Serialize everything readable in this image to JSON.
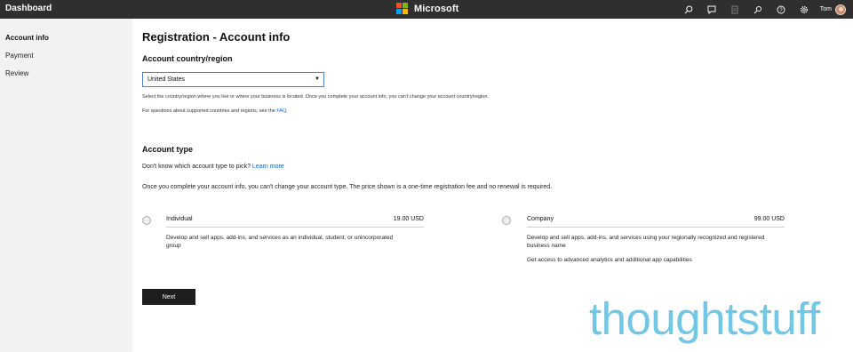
{
  "topbar": {
    "dashboard": "Dashboard",
    "brand": "Microsoft",
    "user": "Tom",
    "icons": [
      "search-icon",
      "chat-icon",
      "document-icon",
      "feedback-icon",
      "help-icon",
      "gear-icon"
    ]
  },
  "sidebar": {
    "items": [
      {
        "label": "Account info",
        "active": true
      },
      {
        "label": "Payment",
        "active": false
      },
      {
        "label": "Review",
        "active": false
      }
    ]
  },
  "main": {
    "title": "Registration - Account info",
    "country": {
      "heading": "Account country/region",
      "selected": "United States",
      "help1": "Select the country/region where you live or where your business is located. Once you complete your account info, you can't change your account country/region.",
      "help2_prefix": "For questions about supported countries and regions, see the ",
      "help2_link": "FAQ",
      "help2_suffix": "."
    },
    "account_type": {
      "heading": "Account type",
      "pick_prefix": "Don't know which account type to pick? ",
      "pick_link": "Learn more",
      "note": "Once you complete your account info, you can't change your account type. The price shown is a one-time registration fee and no renewal is required.",
      "individual": {
        "title": "Individual",
        "price": "19.00 USD",
        "desc": "Develop and sell apps, add-ins, and services as an individual, student, or unincorporated group"
      },
      "company": {
        "title": "Company",
        "price": "99.00 USD",
        "desc1": "Develop and sell apps, add-ins, and services using your regionally recognized and registered business name",
        "desc2": "Get access to advanced analytics and additional app capabilities"
      }
    },
    "next_label": "Next"
  },
  "watermark": "thoughtstuff",
  "colors": {
    "topbar_bg": "#2f2f2f",
    "sidebar_bg": "#f2f2f2",
    "link": "#0f5fc9",
    "select_border": "#4f7ce3",
    "next_bg": "#1e1e1e",
    "watermark": "#72c7e7",
    "ms_logo": [
      "#f25022",
      "#7fba00",
      "#00a4ef",
      "#ffb900"
    ]
  }
}
